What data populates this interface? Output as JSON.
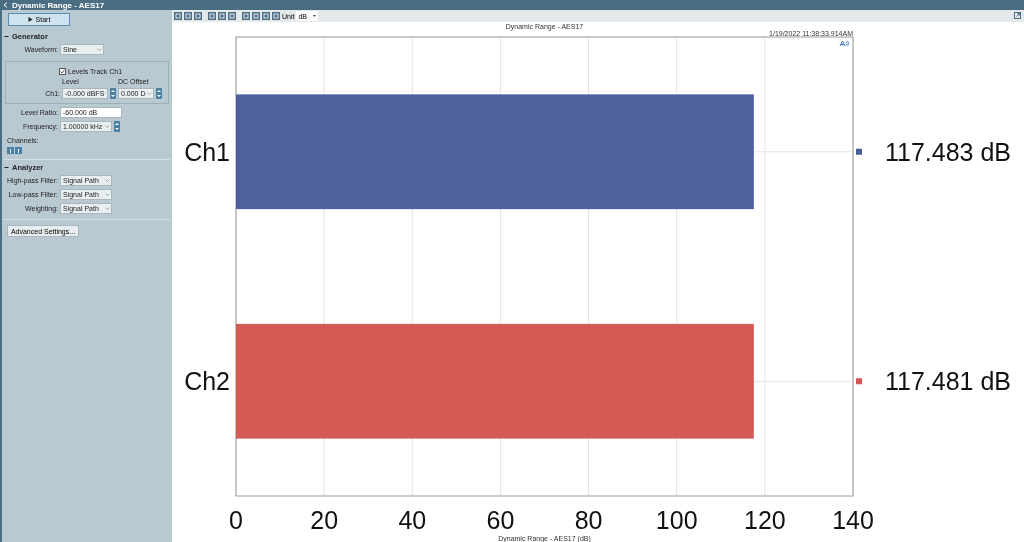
{
  "window": {
    "title": "Dynamic Range - AES17"
  },
  "sidebar": {
    "start_button": "Start",
    "generator": {
      "title": "Generator",
      "expanded": true,
      "waveform": {
        "label": "Waveform:",
        "value": "Sine"
      },
      "levels_track": {
        "label": "Levels Track Ch1",
        "checked": true
      },
      "level_header": "Level",
      "dc_offset_header": "DC Offset",
      "ch1": {
        "label": "Ch1:",
        "level": "-0.000 dBFS",
        "dc_offset": "0.000 D"
      },
      "level_ratio": {
        "label": "Level Ratio:",
        "value": "-60.000 dB"
      },
      "frequency": {
        "label": "Frequency:",
        "value": "1.00000 kHz"
      },
      "channels_label": "Channels:"
    },
    "analyzer": {
      "title": "Analyzer",
      "expanded": true,
      "fields": [
        {
          "label": "High-pass Filter:",
          "value": "Signal Path"
        },
        {
          "label": "Low-pass Filter:",
          "value": "Signal Path"
        },
        {
          "label": "Weighting:",
          "value": "Signal Path"
        }
      ]
    },
    "advanced_button": "Advanced Settings..."
  },
  "toolbar": {
    "unit_label": "Unit",
    "unit": "dB"
  },
  "chart": {
    "timestamp": "1/19/2022 11:38:33.914AM",
    "chart_data": {
      "type": "bar",
      "orientation": "horizontal",
      "title": "Dynamic Range - AES17",
      "xlabel": "Dynamic Range - AES17 (dB)",
      "grid": true,
      "series": [
        {
          "name": "Ch1",
          "color": "#475d99",
          "values": [
            117.5,
            null
          ]
        },
        {
          "name": "Ch2",
          "color": "#d2554f",
          "values": [
            null,
            117.5
          ]
        }
      ],
      "xlim": [
        0,
        140
      ],
      "xticks": [
        0,
        20,
        40,
        60,
        80,
        100,
        120,
        140
      ],
      "value_labels": [
        "117.483 dB",
        "117.481 dB"
      ]
    }
  }
}
